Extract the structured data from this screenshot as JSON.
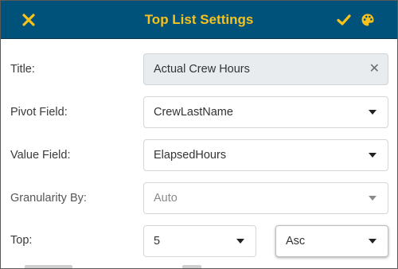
{
  "header": {
    "title": "Top List Settings",
    "close_icon": "close-icon",
    "save_icon": "checkmark-icon",
    "palette_icon": "palette-icon",
    "accent_color": "#f6c21b",
    "bg_color": "#00527a"
  },
  "form": {
    "title_label": "Title:",
    "title_value": "Actual Crew Hours",
    "pivot_label": "Pivot Field:",
    "pivot_value": "CrewLastName",
    "value_label": "Value Field:",
    "value_value": "ElapsedHours",
    "granularity_label": "Granularity By:",
    "granularity_value": "Auto",
    "top_label": "Top:",
    "top_value": "5",
    "order_value": "Asc"
  }
}
